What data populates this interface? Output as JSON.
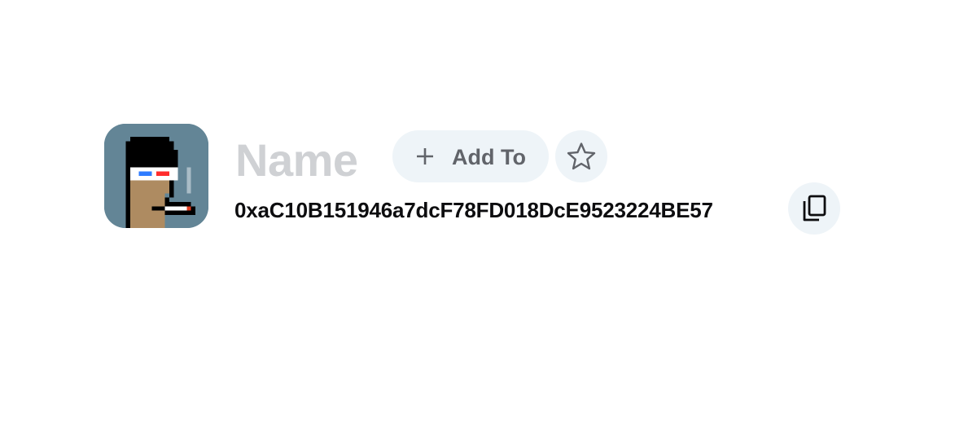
{
  "profile": {
    "name": "Name",
    "address": "0xaC10B151946a7dcF78FD018DcE9523224BE57",
    "avatar_icon": "pixel-art-avatar"
  },
  "actions": {
    "add_to_label": "Add To",
    "add_icon": "plus-icon",
    "favorite_icon": "star-icon",
    "copy_icon": "copy-icon"
  },
  "colors": {
    "avatar_background": "#638596",
    "button_background": "#eef4f8",
    "name_placeholder": "#cfd1d4",
    "button_text": "#61646a",
    "address_text": "#0d0d0f"
  }
}
